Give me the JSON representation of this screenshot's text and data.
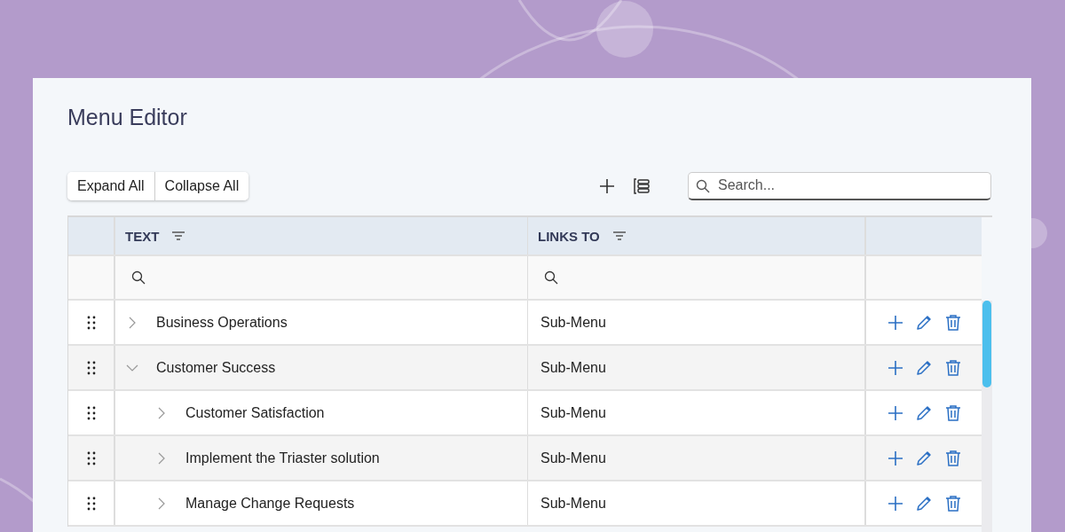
{
  "window": {
    "title": "Menu Editor"
  },
  "toolbar": {
    "buttons": [
      "Expand All",
      "Collapse All"
    ],
    "search": {
      "placeholder": "Search..."
    }
  },
  "table": {
    "columns": [
      {
        "label": "TEXT"
      },
      {
        "label": "LINKS TO"
      }
    ],
    "rows": [
      {
        "text": "Business Operations",
        "links_to": "Sub-Menu",
        "expanded": false
      },
      {
        "text": "Customer Success",
        "links_to": "Sub-Menu",
        "expanded": true,
        "children": [
          {
            "text": "Customer Satisfaction",
            "links_to": "Sub-Menu",
            "expanded": false
          },
          {
            "text": "Implement the Triaster solution",
            "links_to": "Sub-Menu",
            "expanded": false
          },
          {
            "text": "Manage Change Requests",
            "links_to": "Sub-Menu",
            "expanded": false
          }
        ]
      }
    ]
  }
}
